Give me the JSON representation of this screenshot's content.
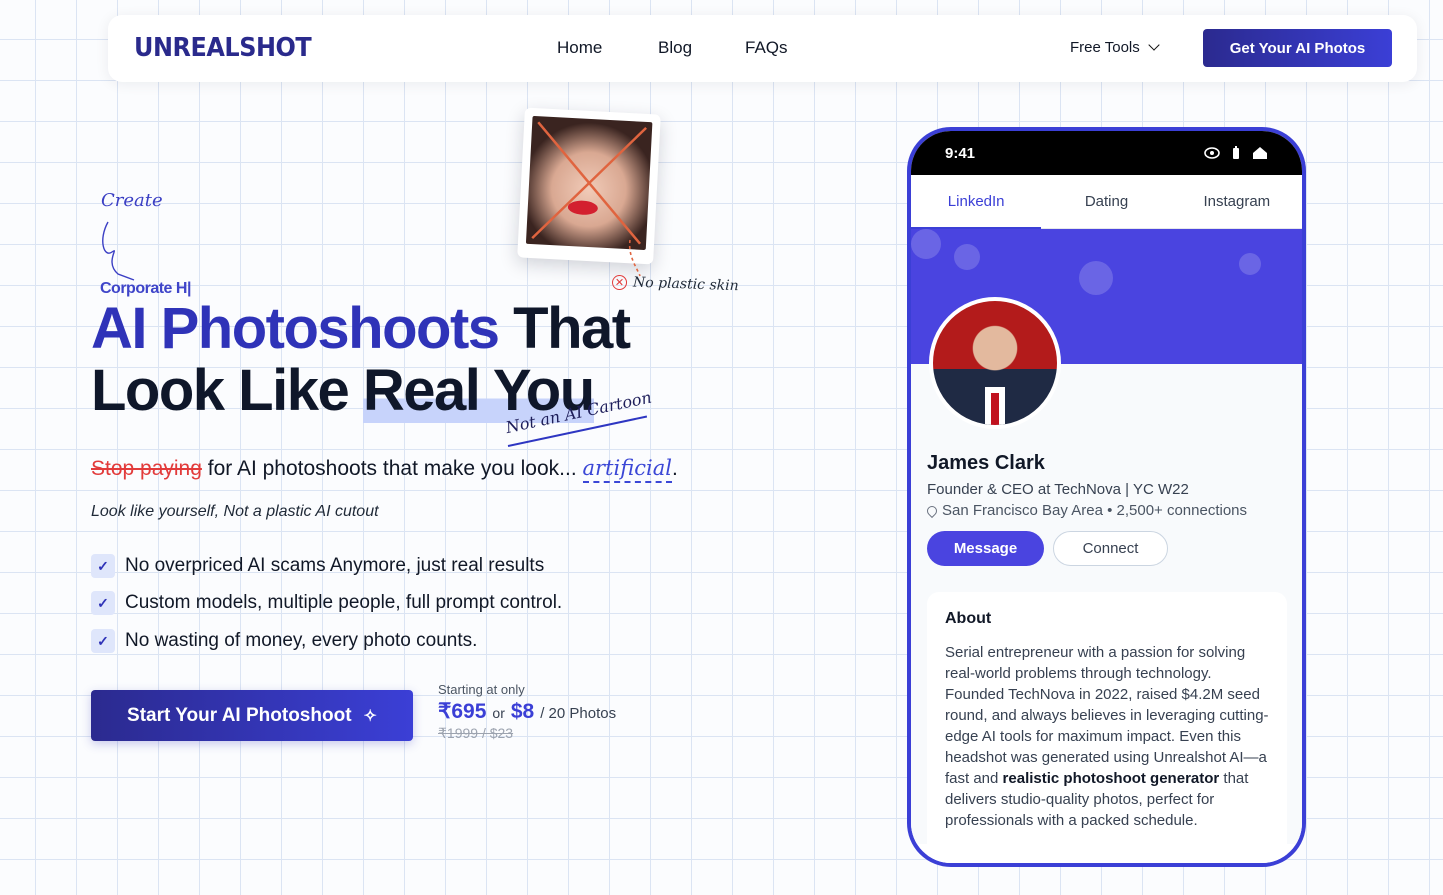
{
  "nav": {
    "logo": "UNREALSHOT",
    "links": [
      "Home",
      "Blog",
      "FAQs"
    ],
    "free_tools": "Free Tools",
    "cta": "Get Your AI Photos"
  },
  "hero": {
    "create_note": "Create",
    "corporate_note": "Corporate H|",
    "title_accent": "AI Photoshoots",
    "title_rest_1": "That",
    "title_line2_a": "Look Like",
    "title_line2_b": "Real You",
    "not_cartoon": "Not an AI Cartoon",
    "no_plastic": "No plastic skin",
    "sub_strike": "Stop paying",
    "sub_main": "for AI photoshoots that make you look...",
    "sub_word": "artificial",
    "sub_end": ".",
    "tagline": "Look like yourself, Not a plastic AI cutout",
    "features": [
      "No overpriced AI scams Anymore, just real results",
      "Custom models, multiple people, full prompt control.",
      "No wasting of money, every photo counts."
    ],
    "start_button": "Start Your AI Photoshoot",
    "price": {
      "starting": "Starting at only",
      "inr": "₹695",
      "or": "or",
      "usd": "$8",
      "per": "/ 20 Photos",
      "old": "₹1999 / $23"
    }
  },
  "phone": {
    "time": "9:41",
    "tabs": [
      "LinkedIn",
      "Dating",
      "Instagram"
    ],
    "active_tab": "LinkedIn",
    "name": "James Clark",
    "role": "Founder & CEO at TechNova | YC W22",
    "location": "San Francisco Bay Area • 2,500+ connections",
    "message_button": "Message",
    "connect_button": "Connect",
    "about_title": "About",
    "about_text_1": "Serial entrepreneur with a passion for solving real-world problems through technology. Founded TechNova in 2022, raised $4.2M seed round, and always believes in leveraging cutting-edge AI tools for maximum impact. Even this headshot was generated using Unrealshot AI—a fast and ",
    "about_bold": "realistic photoshoot generator",
    "about_text_2": " that delivers studio-quality photos, perfect for professionals with a packed schedule."
  },
  "colors": {
    "accent": "#3b3fd6",
    "brand_dark": "#2a2a8c",
    "strike_red": "#e23b3b",
    "cover": "#4a44e0"
  }
}
